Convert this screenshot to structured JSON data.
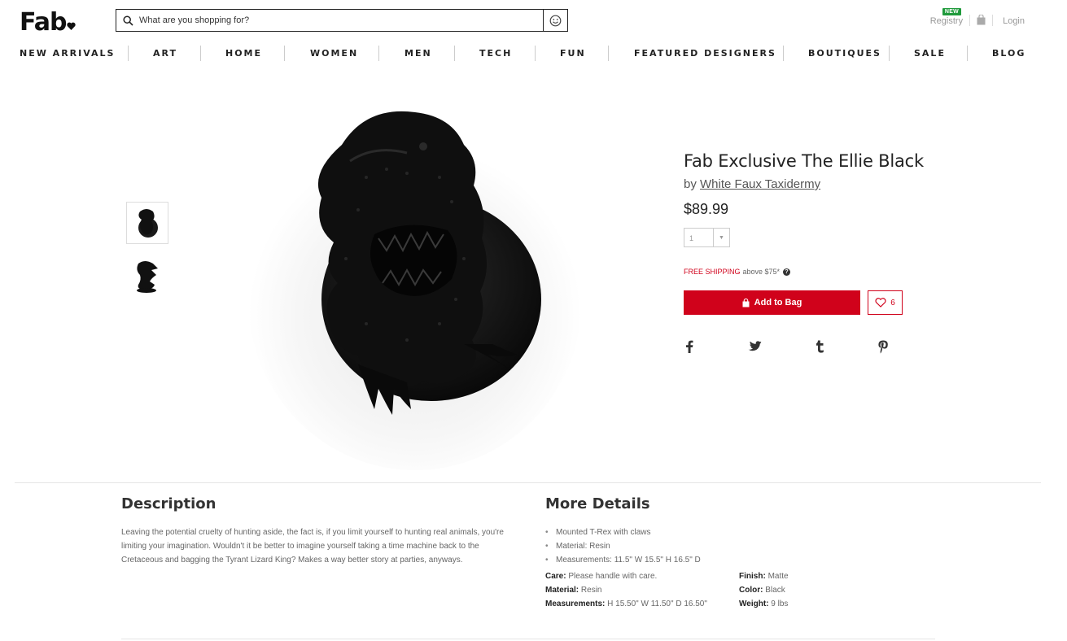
{
  "header": {
    "logo": "Fab",
    "search_placeholder": "What are you shopping for?",
    "registry_label": "Registry",
    "new_badge": "NEW",
    "login_label": "Login"
  },
  "nav": [
    "NEW ARRIVALS",
    "ART",
    "HOME",
    "WOMEN",
    "MEN",
    "TECH",
    "FUN",
    "FEATURED DESIGNERS",
    "BOUTIQUES",
    "SALE",
    "BLOG"
  ],
  "product": {
    "title": "Fab Exclusive The Ellie Black",
    "by_prefix": "by",
    "designer": "White Faux Taxidermy",
    "price": "$89.99",
    "quantity": "1",
    "free_shipping": "FREE SHIPPING",
    "shipping_text": "above $75*",
    "add_to_bag": "Add to Bag",
    "fav_count": "6",
    "colors": {
      "accent": "#d0021b",
      "new_badge": "#1f9a3b"
    }
  },
  "description": {
    "heading": "Description",
    "body": "Leaving the potential cruelty of hunting aside, the fact is, if you limit yourself to hunting real animals, you're limiting your imagination. Wouldn't it be better to imagine yourself taking a time machine back to the Cretaceous and bagging the Tyrant Lizard King? Makes a way better story at parties, anyways."
  },
  "details": {
    "heading": "More Details",
    "bullets": [
      "Mounted T-Rex with claws",
      "Material: Resin",
      "Measurements: 11.5\" W 15.5\" H 16.5\" D"
    ],
    "care_label": "Care:",
    "care_value": "Please handle with care.",
    "material_label": "Material:",
    "material_value": "Resin",
    "measurements_label": "Measurements:",
    "measurements_value": "H 15.50\" W 11.50\" D 16.50\"",
    "finish_label": "Finish:",
    "finish_value": "Matte",
    "color_label": "Color:",
    "color_value": "Black",
    "weight_label": "Weight:",
    "weight_value": "9 lbs"
  },
  "social": [
    "facebook-icon",
    "twitter-icon",
    "tumblr-icon",
    "pinterest-icon"
  ]
}
